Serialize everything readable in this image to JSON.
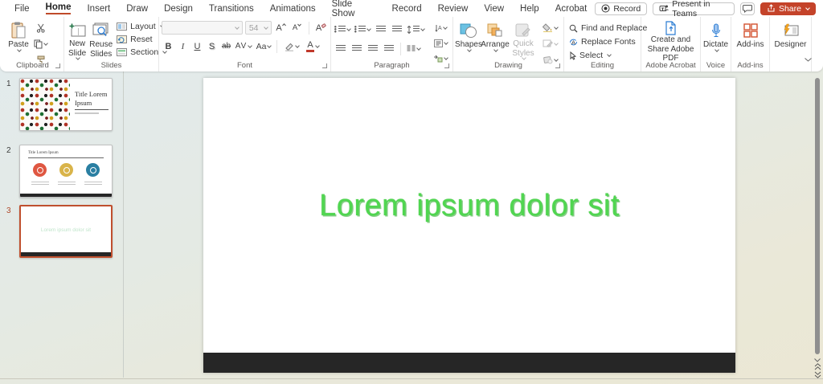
{
  "menu_bar": {
    "items": [
      "File",
      "Home",
      "Insert",
      "Draw",
      "Design",
      "Transitions",
      "Animations",
      "Slide Show",
      "Record",
      "Review",
      "View",
      "Help",
      "Acrobat"
    ],
    "active_item": "Home",
    "record_button": "Record",
    "present_button": "Present in Teams",
    "share_button": "Share"
  },
  "ribbon": {
    "clipboard": {
      "paste": "Paste",
      "label": "Clipboard"
    },
    "slides": {
      "new_slide": "New Slide",
      "reuse_slides": "Reuse Slides",
      "layout": "Layout",
      "reset": "Reset",
      "section": "Section",
      "label": "Slides"
    },
    "font": {
      "name_value": "",
      "size_value": "54",
      "bold_glyph": "B",
      "italic_glyph": "I",
      "underline_glyph": "U",
      "shadow_glyph": "S",
      "strike_glyph": "ab",
      "spacing_glyph": "AV",
      "case_glyph": "Aa",
      "color_glyph": "A",
      "label": "Font"
    },
    "paragraph": {
      "label": "Paragraph"
    },
    "drawing": {
      "shapes": "Shapes",
      "arrange": "Arrange",
      "quick_styles": "Quick Styles",
      "label": "Drawing"
    },
    "editing": {
      "find": "Find and Replace",
      "replace_fonts": "Replace Fonts",
      "select": "Select",
      "label": "Editing"
    },
    "adobe_acrobat": {
      "create_pdf": "Create and Share Adobe PDF",
      "label": "Adobe Acrobat"
    },
    "voice": {
      "dictate": "Dictate",
      "label": "Voice"
    },
    "add_ins": {
      "button": "Add-ins",
      "label": "Add-ins"
    },
    "designer": {
      "button": "Designer"
    }
  },
  "slide_panel": {
    "slides": [
      {
        "number": "1",
        "title": "Title Lorem Ipsum"
      },
      {
        "number": "2",
        "title": "Title Lorem Ipsum"
      },
      {
        "number": "3"
      }
    ]
  },
  "canvas": {
    "text": "Lorem ipsum dolor sit",
    "text_color": "#4ad24a"
  },
  "colors": {
    "share_button": "#c4432a",
    "accent_red": "#bf4a2a",
    "selected_slide_border": "#c0502f",
    "slide_bottom_bar": "#262626",
    "dictate_blue": "#2b7cd3",
    "addins_orange": "#d35230"
  }
}
